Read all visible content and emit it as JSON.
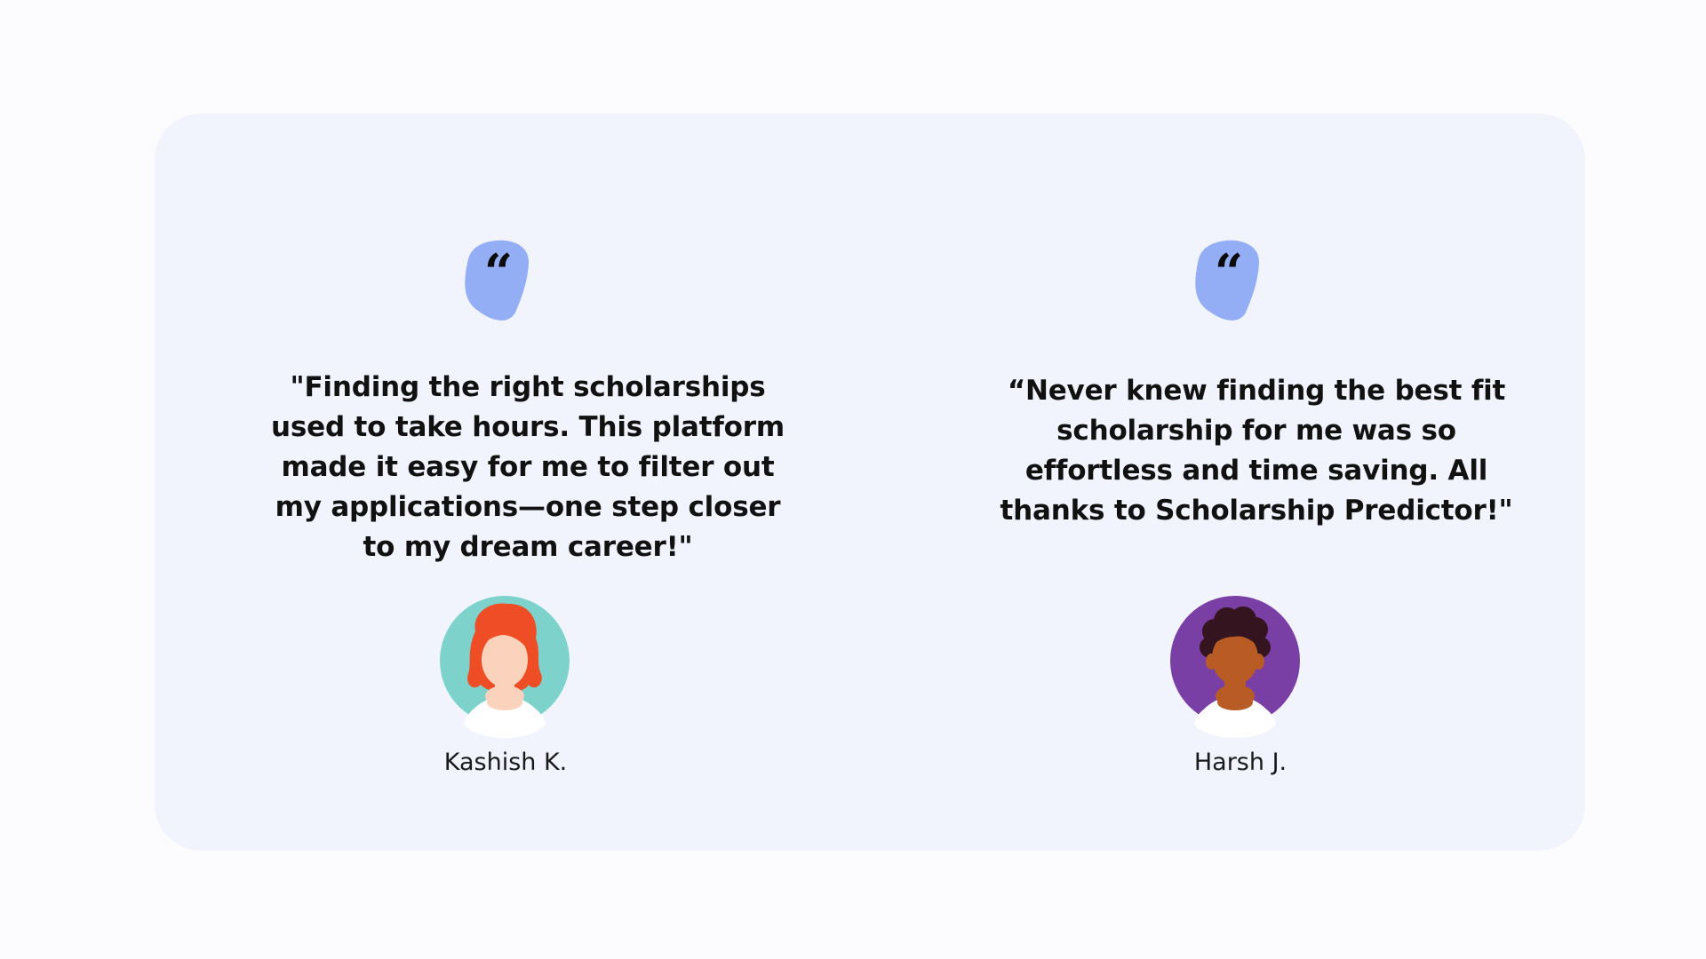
{
  "colors": {
    "page_background": "#fcfcff",
    "card_background": "#f1f4fd",
    "quote_badge": "#94aef5",
    "quote_glyph": "#0b0b0b",
    "text": "#111111"
  },
  "testimonials": [
    {
      "quote_icon": "quote-icon",
      "quote": "\"Finding the right scholarships used to take hours. This platform made it easy for me to filter out my applications—one step closer to my dream career!\"",
      "name": "Kashish K.",
      "avatar": {
        "icon": "female-avatar-icon",
        "bg_color": "#7dd3cc",
        "hair_color": "#ef4d25",
        "skin_color": "#fbd3bd",
        "shirt_color": "#ffffff"
      }
    },
    {
      "quote_icon": "quote-icon",
      "quote": "“Never knew finding the best fit scholarship for me was so effortless and time saving. All thanks to Scholarship Predictor!\"",
      "name": "Harsh J.",
      "avatar": {
        "icon": "male-avatar-icon",
        "bg_color": "#7a3fa5",
        "hair_color": "#34151f",
        "skin_color": "#b85b25",
        "shirt_color": "#ffffff"
      }
    }
  ]
}
